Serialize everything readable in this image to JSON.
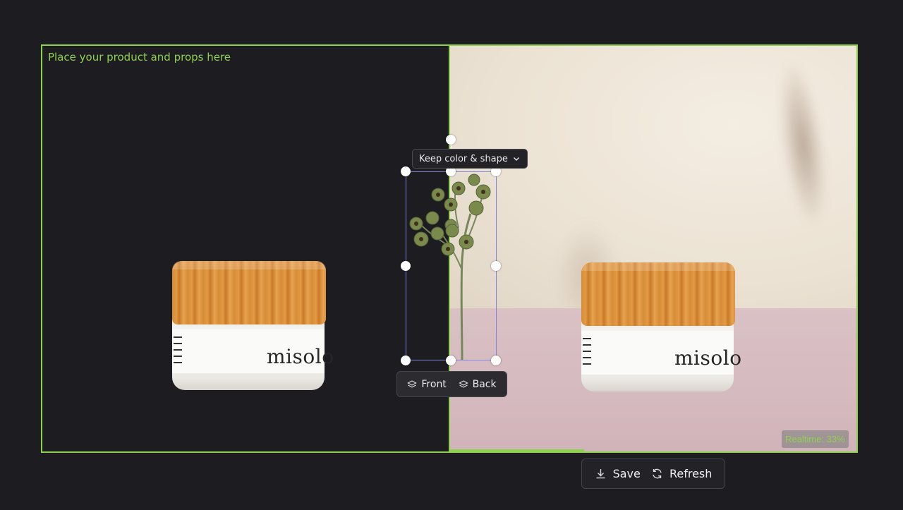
{
  "canvas": {
    "hint": "Place your product and props here"
  },
  "prop_controls": {
    "mode_label": "Keep color & shape",
    "front_label": "Front",
    "back_label": "Back"
  },
  "preview": {
    "status": "Realtime: 33%",
    "progress": 0.33
  },
  "product": {
    "brand": "misolo"
  },
  "actions": {
    "save_label": "Save",
    "refresh_label": "Refresh"
  },
  "colors": {
    "accent": "#8fd14f",
    "background": "#1c1c21",
    "selection": "#7d86d8"
  },
  "icons": {
    "mode_dropdown": "chevron-down-icon",
    "front": "layers-icon",
    "back": "layers-icon",
    "save": "download-icon",
    "refresh": "refresh-icon"
  }
}
